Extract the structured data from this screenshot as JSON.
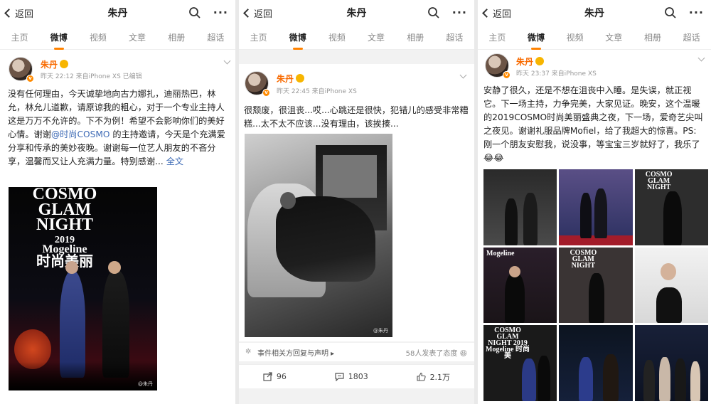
{
  "common": {
    "back_label": "返回",
    "page_title": "朱丹",
    "more_label": "···",
    "tabs": [
      "主页",
      "微博",
      "视频",
      "文章",
      "相册",
      "超话"
    ],
    "active_tab": "微博",
    "accent_color": "#ff8200",
    "username_color": "#f86a00",
    "link_color": "#3d6ab5"
  },
  "panels": [
    {
      "author": "朱丹",
      "meta": "昨天 22:12  来自iPhone XS  已编辑",
      "text_before_link": "没有任何理由，今天诚挚地向古力娜扎，迪丽热巴，林允，林允儿道歉，请原谅我的粗心，对于一个专业主持人这是万万不允许的。下不为例！希望不会影响你们的美好心情。谢谢",
      "mention": "@时尚COSMO",
      "text_after_link": " 的主持邀请，今天是个充满爱 分享和传承的美妙夜晚。谢谢每一位艺人朋友的不吝分享，温馨而又让人充满力量。特别感谢...",
      "expand_label": "全文",
      "photo_caption_lines": [
        "COSMO",
        "GLAM",
        "NIGHT",
        "2019",
        "Mogeline",
        "时尚美丽"
      ],
      "watermark": "@朱丹"
    },
    {
      "author": "朱丹",
      "meta": "昨天 22:45  来自iPhone XS",
      "text": "很颓废，很沮丧...哎...心跳还是很快，犯错儿的感受非常糟糕...太不太不应该...没有理由，该挨揍...",
      "watermark": "@朱丹",
      "event_icon": "✲",
      "event_label": "事件相关方回复与声明 ▸",
      "reactions_label": "58人发表了态度",
      "repost_count": "96",
      "comment_count": "1803",
      "like_count": "2.1万"
    },
    {
      "author": "朱丹",
      "meta": "昨天 23:37  来自iPhone XS",
      "text": "安静了很久，还是不想在沮丧中入睡。是失误，就正视它。下一场主持，力争完美，大家见证。晚安，这个温暖的2019COSMO时尚美丽盛典之夜，下一场，爱奇艺尖叫之夜见。谢谢礼服品牌Mofiel，给了我超大的惊喜。PS: 刚一个朋友安慰我，说没事，等宝宝三岁就好了，我乐了",
      "emoji": "😂😂",
      "grid_cells": [
        {
          "caption": ""
        },
        {
          "caption": ""
        },
        {
          "caption": "COSMO GLAM NIGHT"
        },
        {
          "caption": "Mogeline"
        },
        {
          "caption": "COSMO GLAM NIGHT"
        },
        {
          "caption": ""
        },
        {
          "caption": "COSMO GLAM NIGHT 2019 Mogeline 时尚美"
        },
        {
          "caption": ""
        },
        {
          "caption": ""
        }
      ]
    }
  ]
}
